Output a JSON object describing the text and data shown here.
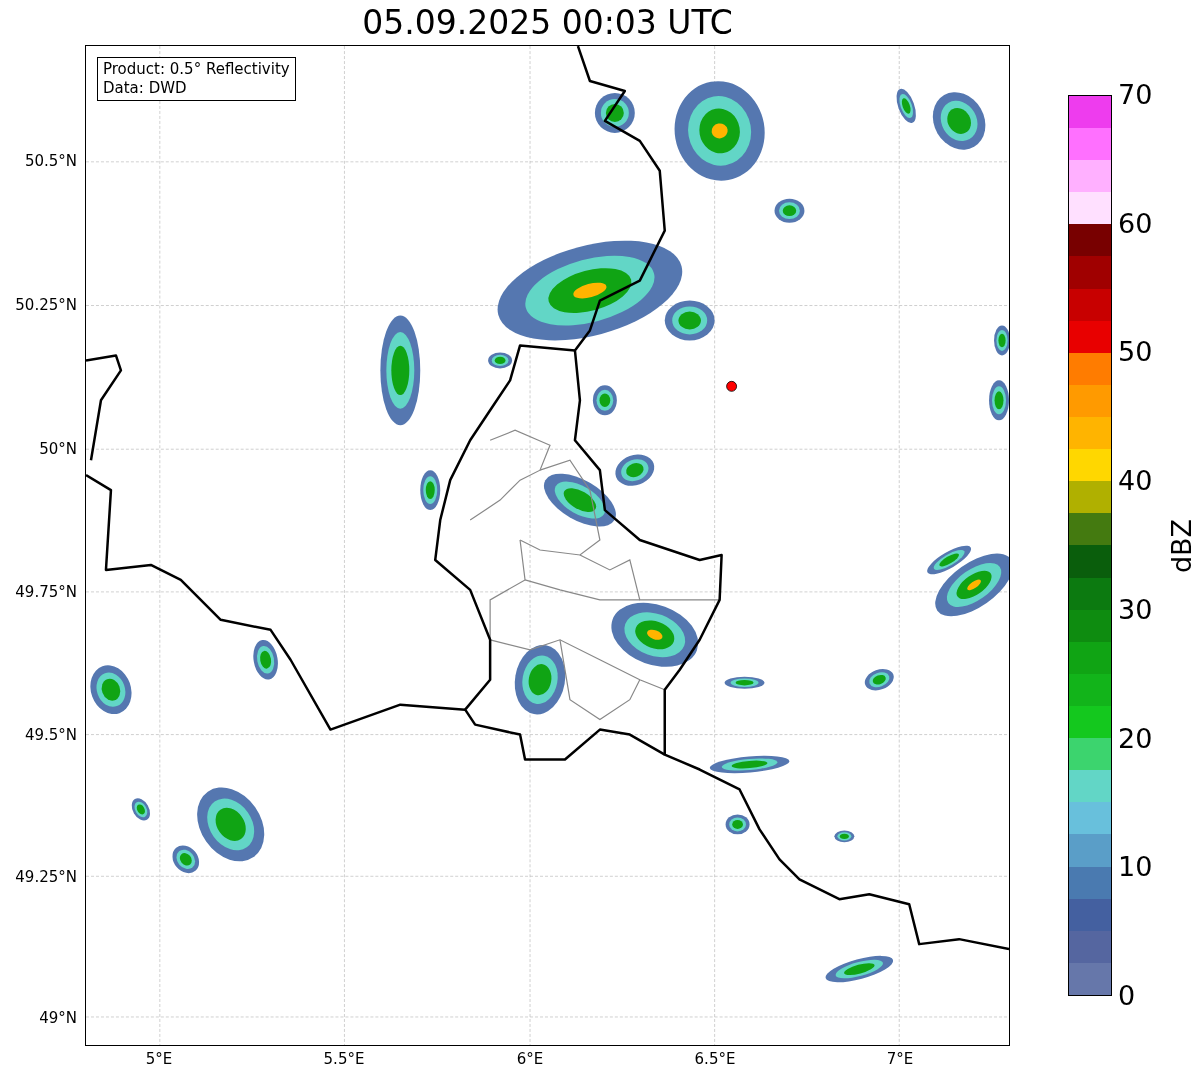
{
  "title": "05.09.2025 00:03 UTC",
  "info_box": [
    "Product: 0.5° Reflectivity",
    "Data: DWD"
  ],
  "y_ticks": [
    "50.5°N",
    "50.25°N",
    "50°N",
    "49.75°N",
    "49.5°N",
    "49.25°N",
    "49°N"
  ],
  "x_ticks": [
    "5°E",
    "5.5°E",
    "6°E",
    "6.5°E",
    "7°E"
  ],
  "colorbar": {
    "label": "dBZ",
    "ticks": [
      "70",
      "60",
      "50",
      "40",
      "30",
      "20",
      "10",
      "0"
    ],
    "segments": [
      {
        "color": "#6677aa"
      },
      {
        "color": "#5566a0"
      },
      {
        "color": "#4460a0"
      },
      {
        "color": "#4a7ab0"
      },
      {
        "color": "#5a9ec8"
      },
      {
        "color": "#68c0dc"
      },
      {
        "color": "#62d6c6"
      },
      {
        "color": "#3cd46e"
      },
      {
        "color": "#14c81e"
      },
      {
        "color": "#12b41a"
      },
      {
        "color": "#10a414"
      },
      {
        "color": "#0e8c10"
      },
      {
        "color": "#0c7a10"
      },
      {
        "color": "#0a5e0c"
      },
      {
        "color": "#447a10"
      },
      {
        "color": "#b0b000"
      },
      {
        "color": "#ffd700"
      },
      {
        "color": "#ffb400"
      },
      {
        "color": "#ff9a00"
      },
      {
        "color": "#ff7c00"
      },
      {
        "color": "#e80000"
      },
      {
        "color": "#c80000"
      },
      {
        "color": "#a00000"
      },
      {
        "color": "#780000"
      },
      {
        "color": "#ffe0ff"
      },
      {
        "color": "#ffb0ff"
      },
      {
        "color": "#ff70ff"
      },
      {
        "color": "#ee3cee"
      }
    ]
  }
}
